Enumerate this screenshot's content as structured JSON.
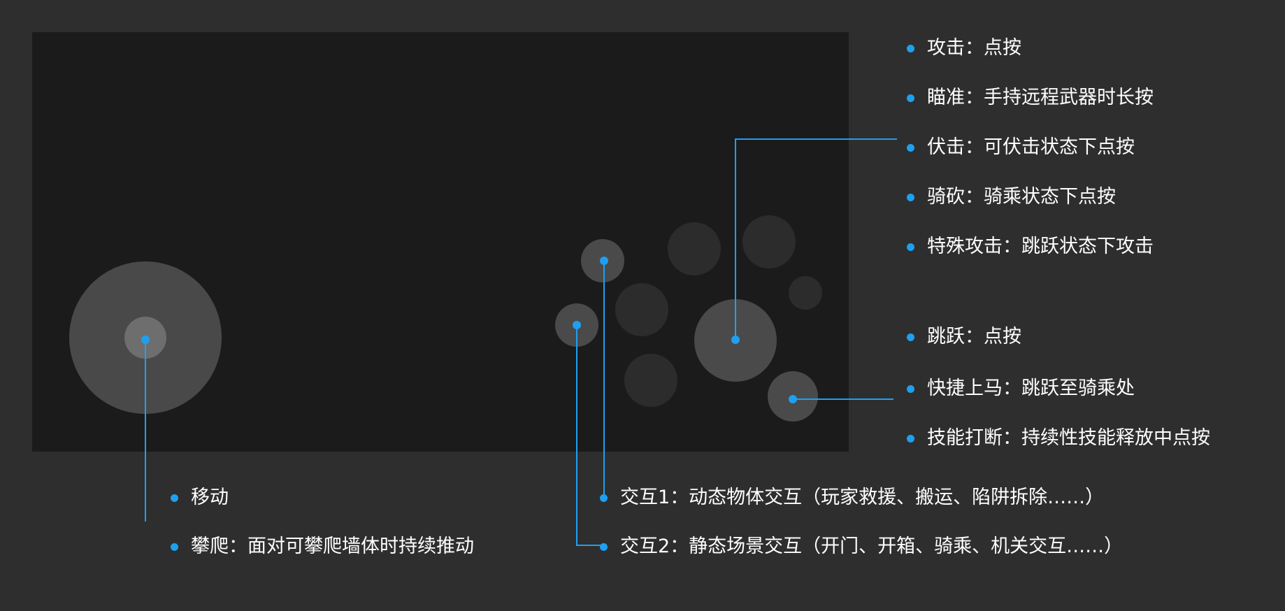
{
  "colors": {
    "background": "#2e2e2e",
    "screen": "#1b1b1b",
    "accent": "#1ea0f0",
    "text": "#ffffff"
  },
  "controls": {
    "move": "移动",
    "climb": "攀爬：面对可攀爬墙体时持续推动",
    "interact1": "交互1：动态物体交互（玩家救援、搬运、陷阱拆除……）",
    "interact2": "交互2：静态场景交互（开门、开箱、骑乘、机关交互……）",
    "attack": "攻击：点按",
    "aim": "瞄准：手持远程武器时长按",
    "ambush": "伏击：可伏击状态下点按",
    "ride_slash": "骑砍：骑乘状态下点按",
    "special_attack": "特殊攻击：跳跃状态下攻击",
    "jump": "跳跃：点按",
    "quick_mount": "快捷上马：跳跃至骑乘处",
    "skill_interrupt": "技能打断：持续性技能释放中点按"
  }
}
